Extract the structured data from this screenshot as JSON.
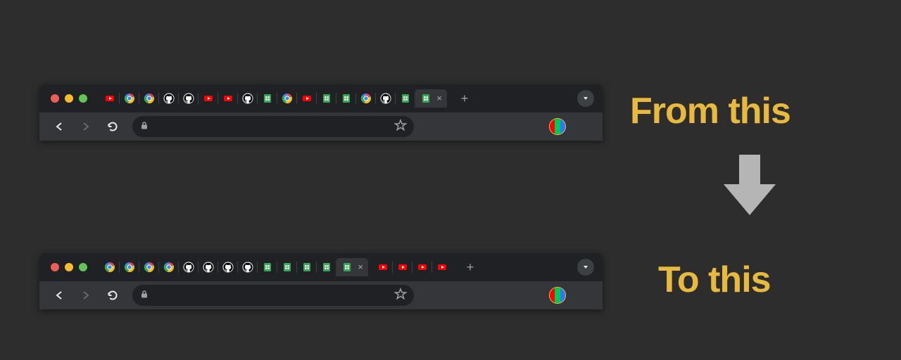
{
  "headline1": "From this",
  "headline2": "To this",
  "favicon_types": {
    "youtube": {
      "bg": "#ff0000"
    },
    "chrome": {},
    "github": {},
    "sheets": {
      "bg": "#34a853"
    }
  },
  "windows": {
    "top": {
      "tabs": [
        "youtube",
        "chrome",
        "chrome",
        "github",
        "github",
        "youtube",
        "youtube",
        "github",
        "sheets",
        "chrome",
        "youtube",
        "sheets",
        "sheets",
        "chrome",
        "github",
        "sheets",
        "sheets"
      ],
      "active_index": 16
    },
    "bottom": {
      "groups": [
        [
          "chrome",
          "chrome",
          "chrome",
          "chrome"
        ],
        [
          "github",
          "github",
          "github",
          "github"
        ],
        [
          "sheets",
          "sheets",
          "sheets",
          "sheets",
          "sheets"
        ]
      ],
      "after_active": [
        "youtube",
        "youtube",
        "youtube",
        "youtube"
      ],
      "active_index_in_last_group": 4
    }
  },
  "ext_stripes": [
    "#ff0000",
    "#00c853",
    "#2979ff"
  ],
  "new_tab_label": "+",
  "close_label": "×"
}
